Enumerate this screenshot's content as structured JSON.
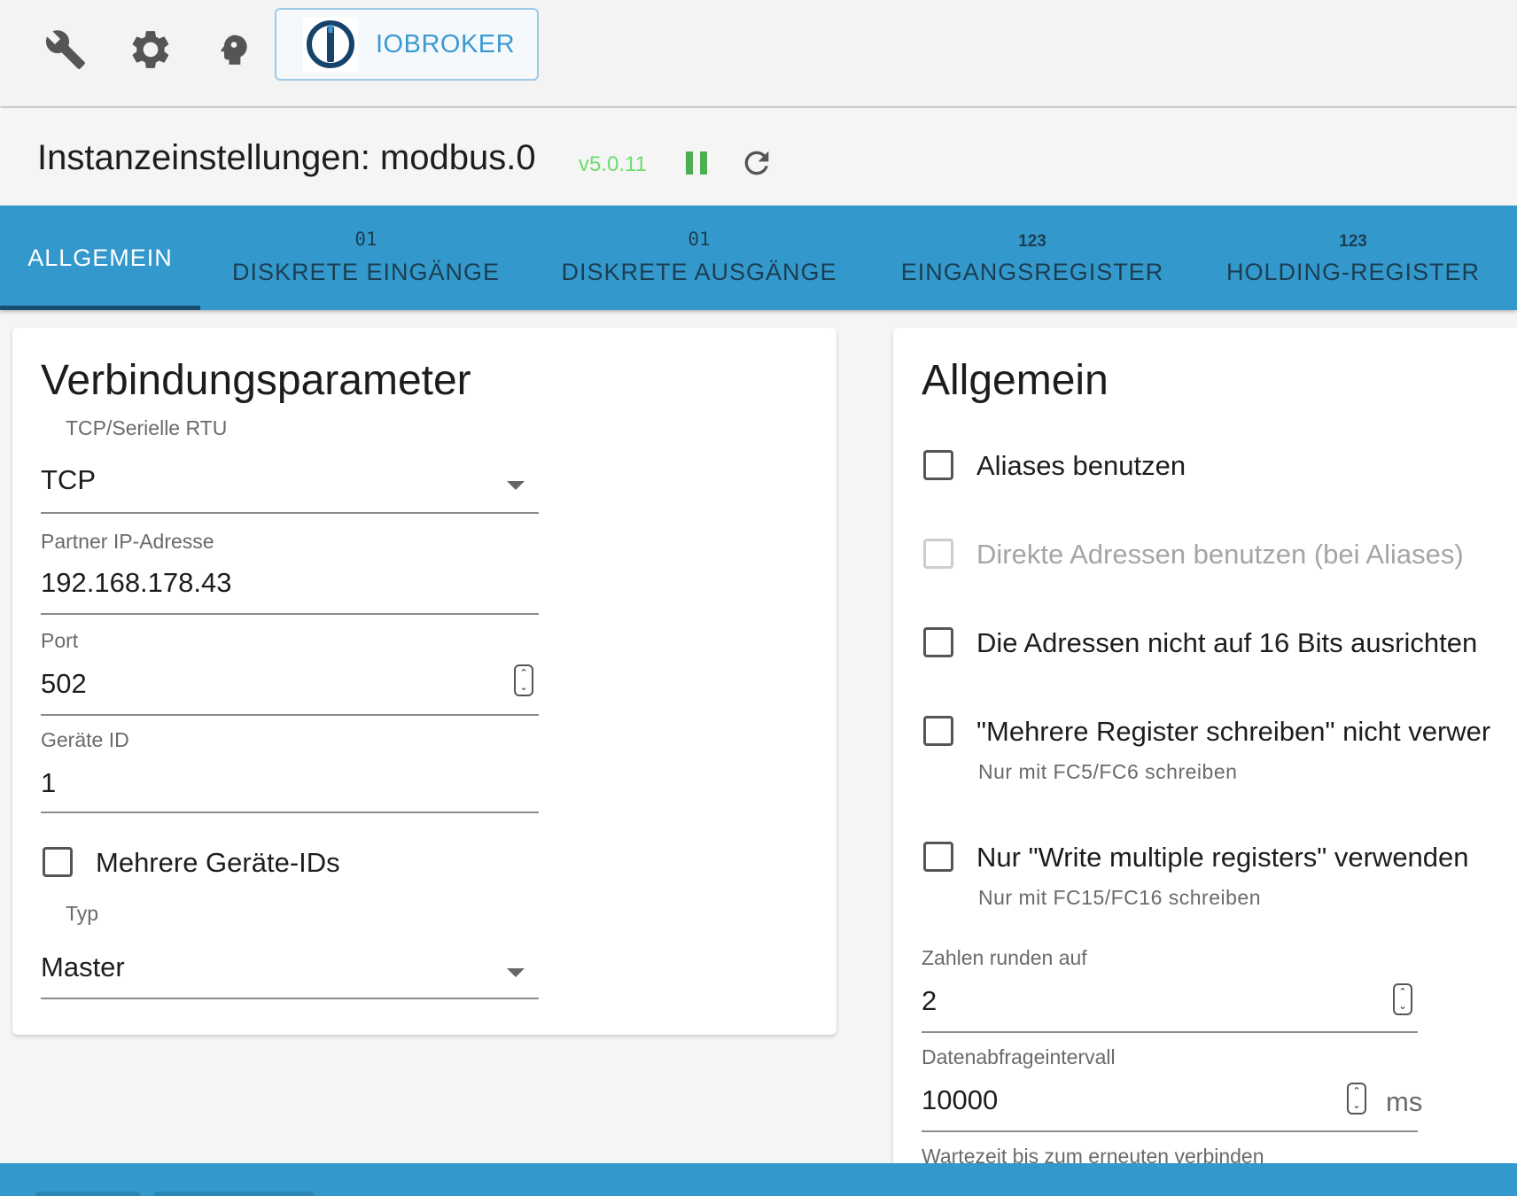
{
  "toolbar": {
    "icons": [
      "wrench-icon",
      "gear-icon",
      "expert-mode-icon"
    ],
    "brand_label": "IOBROKER"
  },
  "header": {
    "title": "Instanzeinstellungen: modbus.0",
    "version": "v5.0.11",
    "pause_color": "#4caf50"
  },
  "tabs": [
    {
      "icon": "",
      "label": "ALLGEMEIN"
    },
    {
      "icon": "01",
      "label": "DISKRETE EINGÄNGE"
    },
    {
      "icon": "01",
      "label": "DISKRETE AUSGÄNGE"
    },
    {
      "icon": "123",
      "label": "EINGANGSREGISTER"
    },
    {
      "icon": "123",
      "label": "HOLDING-REGISTER"
    }
  ],
  "connection": {
    "title": "Verbindungsparameter",
    "mode_label": "TCP/Serielle RTU",
    "mode_value": "TCP",
    "ip_label": "Partner IP-Adresse",
    "ip_value": "192.168.178.43",
    "port_label": "Port",
    "port_value": "502",
    "device_id_label": "Geräte ID",
    "device_id_value": "1",
    "multi_ids_label": "Mehrere Geräte-IDs",
    "type_label": "Typ",
    "type_value": "Master"
  },
  "general": {
    "title": "Allgemein",
    "options": [
      {
        "label": "Aliases benutzen",
        "help": "",
        "disabled": false
      },
      {
        "label": "Direkte Adressen benutzen (bei Aliases)",
        "help": "",
        "disabled": true
      },
      {
        "label": "Die Adressen nicht auf 16 Bits ausrichten",
        "help": "",
        "disabled": false
      },
      {
        "label": "\"Mehrere Register schreiben\" nicht verwer",
        "help": "Nur mit FC5/FC6 schreiben",
        "disabled": false
      },
      {
        "label": "Nur \"Write multiple registers\" verwenden",
        "help": "Nur mit FC15/FC16 schreiben",
        "disabled": false
      }
    ],
    "round_label": "Zahlen runden auf",
    "round_value": "2",
    "poll_label": "Datenabfrageintervall",
    "poll_value": "10000",
    "poll_unit": "ms",
    "reconnect_label": "Wartezeit bis zum erneuten verbinden"
  },
  "colors": {
    "accent": "#3399cc",
    "version": "#6ddc6d",
    "brand": "#3b9ad3"
  }
}
